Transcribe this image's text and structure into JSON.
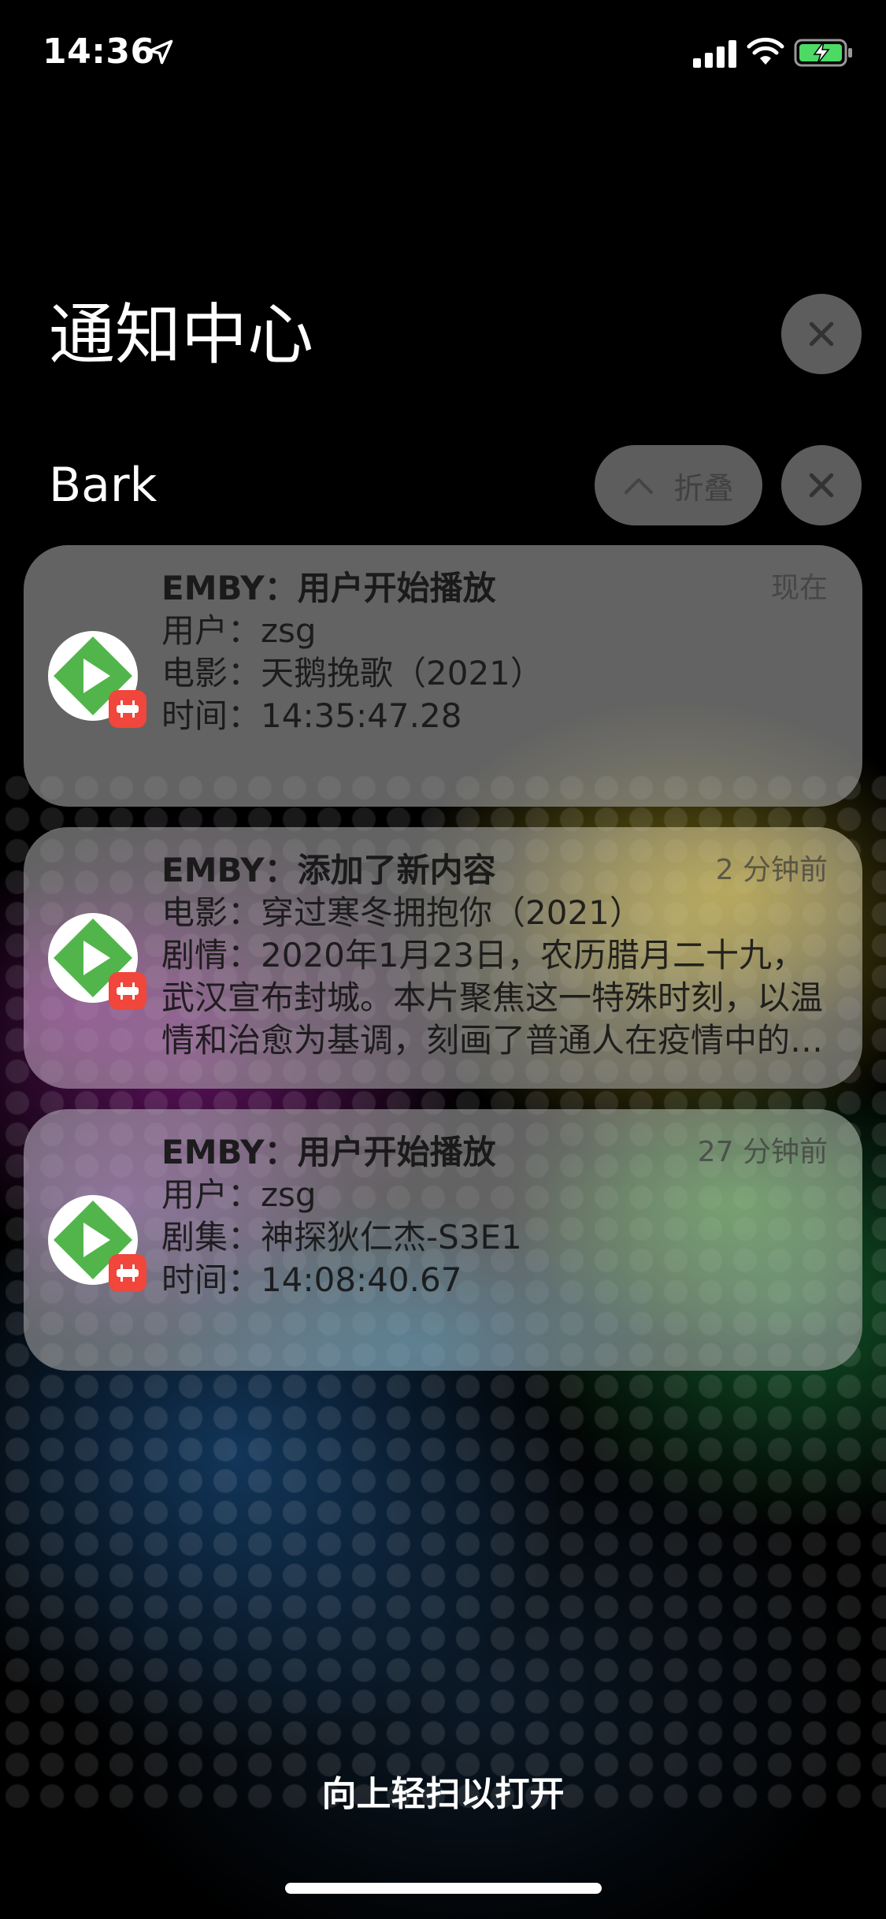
{
  "status_bar": {
    "time": "14:36",
    "icons": [
      "location-arrow-icon",
      "cellular-signal-icon",
      "wifi-icon",
      "battery-charging-icon"
    ]
  },
  "notification_center": {
    "title": "通知中心"
  },
  "group": {
    "app_name": "Bark",
    "collapse_label": "折叠"
  },
  "notifications": [
    {
      "title": "EMBY：用户开始播放",
      "time": "现在",
      "lines": [
        "用户：zsg",
        "电影：天鹅挽歌（2021）",
        "时间：14:35:47.28"
      ]
    },
    {
      "title": "EMBY：添加了新内容",
      "time": "2 分钟前",
      "lines": [
        "电影：穿过寒冬拥抱你（2021）"
      ],
      "description": "剧情：2020年1月23日，农历腊月二十九，武汉宣布封城。本片聚焦这一特殊时刻，以温情和治愈为基调，刻画了普通人在疫情中的生活"
    },
    {
      "title": "EMBY：用户开始播放",
      "time": "27 分钟前",
      "lines": [
        "用户：zsg",
        "剧集：神探狄仁杰-S3E1",
        "时间：14:08:40.67"
      ]
    }
  ],
  "footer": {
    "swipe_hint": "向上轻扫以打开"
  },
  "colors": {
    "emby_green": "#52B54B",
    "badge_red": "#F0463C",
    "glass_button": "#969696"
  }
}
